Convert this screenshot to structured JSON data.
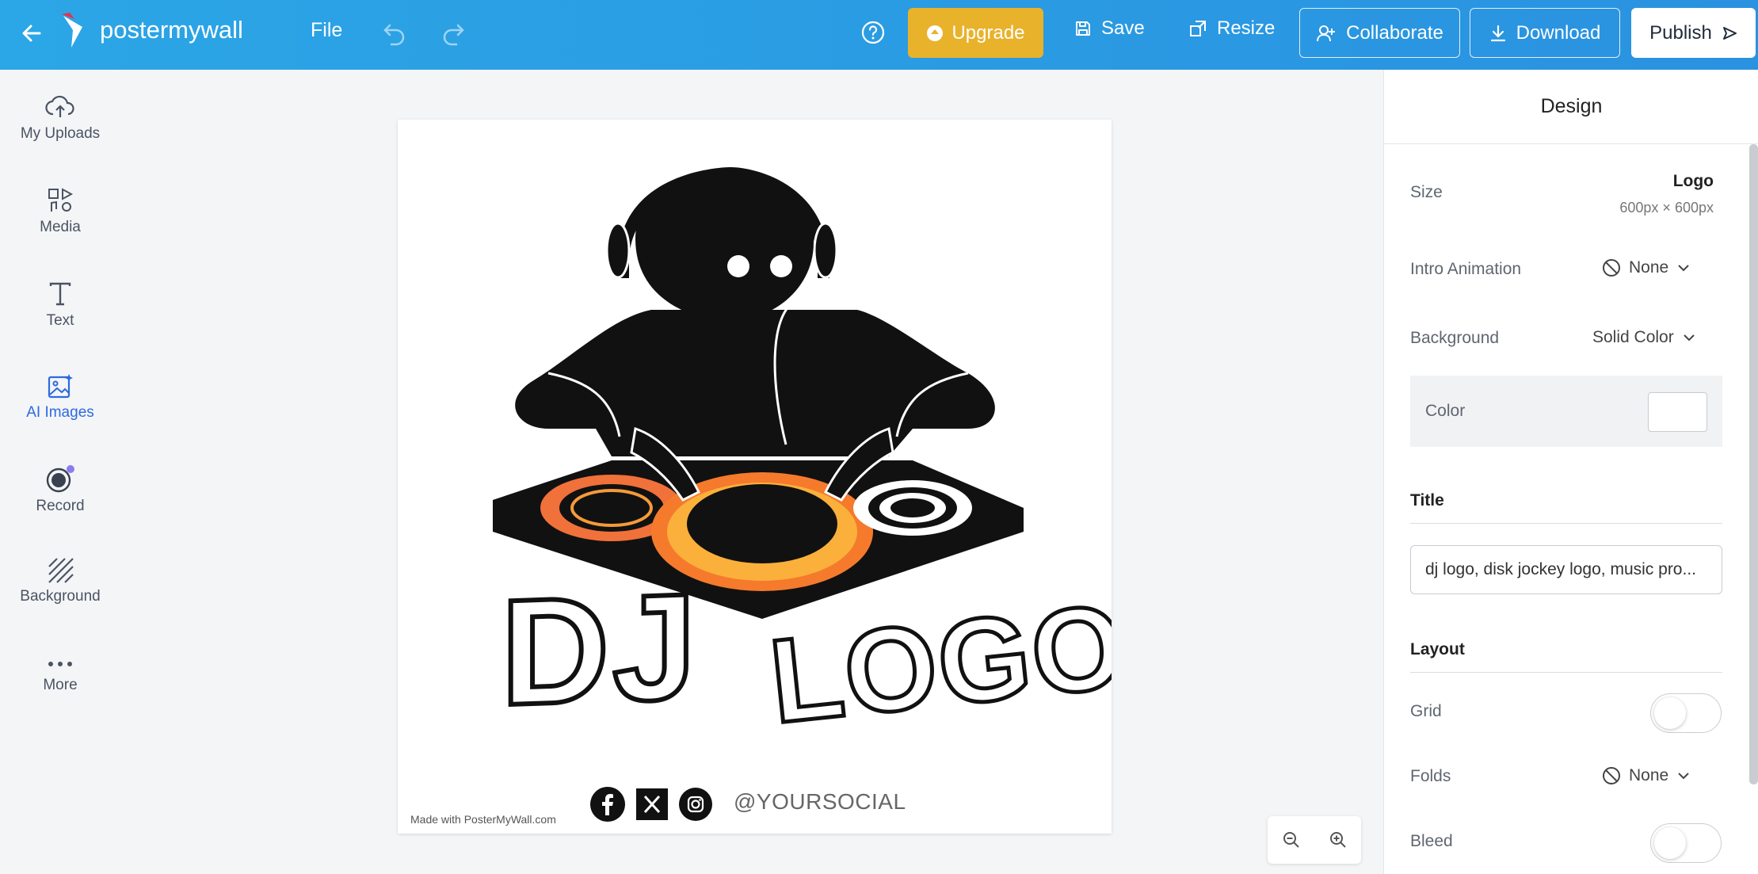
{
  "topbar": {
    "brand": "postermywall",
    "file_label": "File",
    "upgrade_label": "Upgrade",
    "save_label": "Save",
    "resize_label": "Resize",
    "collaborate_label": "Collaborate",
    "download_label": "Download",
    "publish_label": "Publish"
  },
  "sidebar": {
    "items": [
      {
        "label": "My Uploads",
        "icon": "upload-cloud-icon"
      },
      {
        "label": "Media",
        "icon": "media-icon"
      },
      {
        "label": "Text",
        "icon": "text-icon"
      },
      {
        "label": "AI Images",
        "icon": "ai-image-icon"
      },
      {
        "label": "Record",
        "icon": "record-icon"
      },
      {
        "label": "Background",
        "icon": "background-pattern-icon"
      },
      {
        "label": "More",
        "icon": "more-dots-icon"
      }
    ],
    "active": "AI Images"
  },
  "canvas": {
    "logo_text_1": "DJ",
    "logo_text_2": "LOGO",
    "social_handle": "@YOURSOCIAL",
    "watermark": "Made with PosterMyWall.com"
  },
  "panel": {
    "title": "Design",
    "size_label": "Size",
    "size_name": "Logo",
    "size_dims": "600px × 600px",
    "intro_label": "Intro Animation",
    "intro_value": "None",
    "background_label": "Background",
    "background_value": "Solid Color",
    "color_label": "Color",
    "color_value": "#ffffff",
    "title_section": "Title",
    "title_value": "dj logo, disk jockey logo, music pro...",
    "layout_section": "Layout",
    "grid_label": "Grid",
    "folds_label": "Folds",
    "folds_value": "None",
    "bleed_label": "Bleed"
  },
  "colors": {
    "topbar": "#2a9fe4",
    "upgrade": "#e8b22b",
    "accent": "#2d6ae0"
  }
}
